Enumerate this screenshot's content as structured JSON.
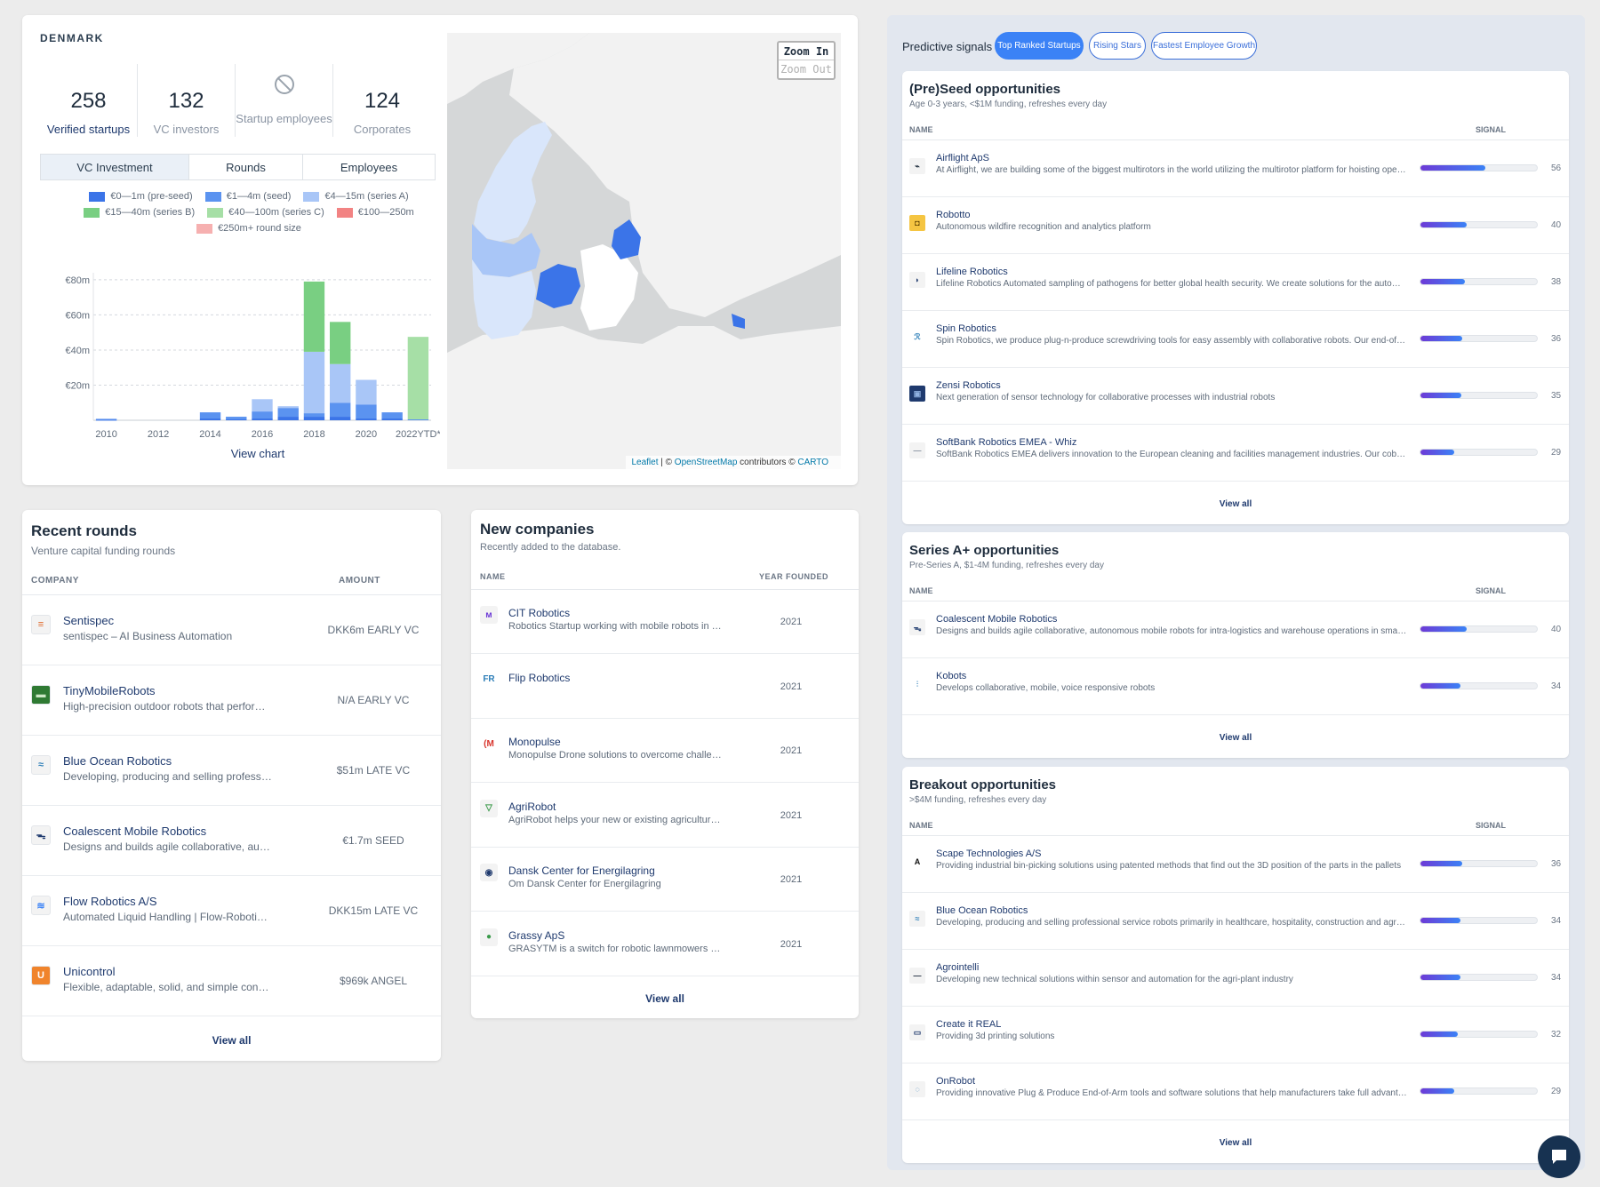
{
  "overview": {
    "country": "DENMARK",
    "stats": [
      {
        "value": "258",
        "label": "Verified startups"
      },
      {
        "value": "132",
        "label": "VC investors"
      },
      {
        "value": "",
        "label": "Startup employees"
      },
      {
        "value": "124",
        "label": "Corporates"
      }
    ],
    "tabs": [
      "VC Investment",
      "Rounds",
      "Employees"
    ],
    "legend": [
      {
        "label": "€0—1m (pre-seed)",
        "color": "#3b74e8"
      },
      {
        "label": "€1—4m (seed)",
        "color": "#5b93f0"
      },
      {
        "label": "€4—15m (series A)",
        "color": "#a9c6f7"
      },
      {
        "label": "€15—40m (series B)",
        "color": "#79cf82"
      },
      {
        "label": "€40—100m (series C)",
        "color": "#a6dfa6"
      },
      {
        "label": "€100—250m",
        "color": "#f28383"
      },
      {
        "label": "€250m+ round size",
        "color": "#f6b0b0"
      }
    ],
    "view_chart": "View chart"
  },
  "chart_data": {
    "type": "bar",
    "categories": [
      "2010",
      "2011",
      "2012",
      "2013",
      "2014",
      "2015",
      "2016",
      "2017",
      "2018",
      "2019",
      "2020",
      "2021",
      "2022YTD*"
    ],
    "tick_labels": [
      "2010",
      "2012",
      "2014",
      "2016",
      "2018",
      "2020",
      "2022YTD*"
    ],
    "yticks": [
      "€20m",
      "€40m",
      "€60m",
      "€80m"
    ],
    "ylim": [
      0,
      84
    ],
    "stacked": true,
    "series": [
      {
        "name": "€0—1m (pre-seed)",
        "color": "#3b74e8",
        "values": [
          0.3,
          0,
          0,
          0,
          1,
          0.5,
          1,
          2,
          2,
          2,
          1,
          1,
          0
        ]
      },
      {
        "name": "€1—4m (seed)",
        "color": "#5b93f0",
        "values": [
          0.5,
          0,
          0,
          0,
          3.5,
          1.5,
          4,
          5,
          2,
          8,
          8,
          3.5,
          0.5
        ]
      },
      {
        "name": "€4—15m (series A)",
        "color": "#a9c6f7",
        "values": [
          0,
          0,
          0,
          0,
          0,
          0,
          7,
          1,
          35,
          22,
          14,
          0,
          0
        ]
      },
      {
        "name": "€15—40m (series B)",
        "color": "#79cf82",
        "values": [
          0,
          0,
          0,
          0,
          0,
          0,
          0,
          0,
          40,
          24,
          0,
          0,
          0
        ]
      },
      {
        "name": "€40—100m (series C)",
        "color": "#a6dfa6",
        "values": [
          0,
          0,
          0,
          0,
          0,
          0,
          0,
          0,
          0,
          0,
          0,
          0,
          47
        ]
      }
    ]
  },
  "map": {
    "zoom_in": "Zoom In",
    "zoom_out": "Zoom Out",
    "attribution_leaflet": "Leaflet",
    "attribution_sep": " | © ",
    "attribution_osm": "OpenStreetMap",
    "attribution_mid": " contributors © ",
    "attribution_carto": "CARTO"
  },
  "recent_rounds": {
    "title": "Recent rounds",
    "subtitle": "Venture capital funding rounds",
    "col_company": "COMPANY",
    "col_amount": "AMOUNT",
    "rows": [
      {
        "name": "Sentispec",
        "desc": "sentispec – AI Business Automation",
        "amount": "DKK6m EARLY VC",
        "logo_color": "#f3f3f3",
        "logo_text": "≡",
        "logo_fg": "#e06a2c"
      },
      {
        "name": "TinyMobileRobots",
        "desc": "High-precision outdoor robots that perform line marking and layout",
        "amount": "N/A EARLY VC",
        "logo_color": "#2f7a33",
        "logo_text": "▬",
        "logo_fg": "#cde8c6"
      },
      {
        "name": "Blue Ocean Robotics",
        "desc": "Developing, producing and selling professional service robots",
        "amount": "$51m LATE VC",
        "logo_color": "#f3f3f3",
        "logo_text": "≈",
        "logo_fg": "#2e7fb8"
      },
      {
        "name": "Coalescent Mobile Robotics",
        "desc": "Designs and builds agile collaborative, autonomous mobile robots",
        "amount": "€1.7m SEED",
        "logo_color": "#f3f3f3",
        "logo_text": "ᯓ",
        "logo_fg": "#1f3a6e"
      },
      {
        "name": "Flow Robotics A/S",
        "desc": "Automated Liquid Handling | Flow-Robotics flowbot ONE",
        "amount": "DKK15m LATE VC",
        "logo_color": "#f3f3f3",
        "logo_text": "≋",
        "logo_fg": "#3b82f6"
      },
      {
        "name": "Unicontrol",
        "desc": "Flexible, adaptable, solid, and simple construction technology",
        "amount": "$969k ANGEL",
        "logo_color": "#f0842c",
        "logo_text": "U",
        "logo_fg": "#ffffff"
      }
    ],
    "view_all": "View all"
  },
  "new_companies": {
    "title": "New companies",
    "subtitle": "Recently added to the database.",
    "col_name": "NAME",
    "col_year": "YEAR FOUNDED",
    "rows": [
      {
        "name": "CIT Robotics",
        "desc": "Robotics Startup working with mobile robots in logistics",
        "year": "2021",
        "logo_color": "#f3f3f3",
        "logo_text": "ᴍ",
        "logo_fg": "#6d3ad6"
      },
      {
        "name": "Flip Robotics",
        "desc": "",
        "year": "2021",
        "logo_color": "#ffffff",
        "logo_text": "FR",
        "logo_fg": "#2e7fb8"
      },
      {
        "name": "Monopulse",
        "desc": "Monopulse Drone solutions to overcome challenges",
        "year": "2021",
        "logo_color": "#ffffff",
        "logo_text": "(M",
        "logo_fg": "#d8342c"
      },
      {
        "name": "AgriRobot",
        "desc": "AgriRobot helps your new or existing agriculture business",
        "year": "2021",
        "logo_color": "#f3f3f3",
        "logo_text": "▽",
        "logo_fg": "#3a9a4a"
      },
      {
        "name": "Dansk Center for Energilagring",
        "desc": "Om Dansk Center for Energilagring",
        "year": "2021",
        "logo_color": "#f3f3f3",
        "logo_text": "◉",
        "logo_fg": "#1f3a6e"
      },
      {
        "name": "Grassy ApS",
        "desc": "GRASYTM is a switch for robotic lawnmowers and more",
        "year": "2021",
        "logo_color": "#f3f3f3",
        "logo_text": "●",
        "logo_fg": "#3a9a4a"
      }
    ],
    "view_all": "View all"
  },
  "predictive": {
    "label": "Predictive signals",
    "pills": [
      "Top Ranked Startups",
      "Rising Stars",
      "Fastest Employee Growth"
    ],
    "col_name": "NAME",
    "col_signal": "SIGNAL",
    "sections": [
      {
        "title": "(Pre)Seed opportunities",
        "subtitle": "Age 0-3 years, <$1M funding, refreshes every day",
        "view_all": "View all",
        "rows": [
          {
            "name": "Airflight ApS",
            "desc": "At Airflight, we are building some of the biggest multirotors in the world utilizing the multirotor platform for hoisting operations",
            "signal": 56,
            "logo_color": "#f3f3f3",
            "logo_text": "⌁",
            "logo_fg": "#1f2d3d"
          },
          {
            "name": "Robotto",
            "desc": "Autonomous wildfire recognition and analytics platform",
            "signal": 40,
            "logo_color": "#f5c542",
            "logo_text": "◘",
            "logo_fg": "#5a3e00"
          },
          {
            "name": "Lifeline Robotics",
            "desc": "Lifeline Robotics Automated sampling of pathogens for better global health security. We create solutions for the automation of testing",
            "signal": 38,
            "logo_color": "#f3f3f3",
            "logo_text": "◗",
            "logo_fg": "#1f3a6e"
          },
          {
            "name": "Spin Robotics",
            "desc": "Spin Robotics, we produce plug-n-produce screwdriving tools for easy assembly with collaborative robots. Our end-of-arm tools are",
            "signal": 36,
            "logo_color": "#ffffff",
            "logo_text": "ℛ",
            "logo_fg": "#2e7fb8"
          },
          {
            "name": "Zensi Robotics",
            "desc": "Next generation of sensor technology for collaborative processes with industrial robots",
            "signal": 35,
            "logo_color": "#1f3a6e",
            "logo_text": "▣",
            "logo_fg": "#8fb0e0"
          },
          {
            "name": "SoftBank Robotics EMEA - Whiz",
            "desc": "SoftBank Robotics EMEA delivers innovation to the European cleaning and facilities management industries. Our cobotic solutions",
            "signal": 29,
            "logo_color": "#f3f3f3",
            "logo_text": "—",
            "logo_fg": "#8a94a3"
          }
        ]
      },
      {
        "title": "Series A+ opportunities",
        "subtitle": "Pre-Series A, $1-4M funding, refreshes every day",
        "view_all": "View all",
        "rows": [
          {
            "name": "Coalescent Mobile Robotics",
            "desc": "Designs and builds agile collaborative, autonomous mobile robots for intra-logistics and warehouse operations in small and medium",
            "signal": 40,
            "logo_color": "#f3f3f3",
            "logo_text": "ᯓ",
            "logo_fg": "#1f3a6e"
          },
          {
            "name": "Kobots",
            "desc": "Develops collaborative, mobile, voice responsive robots",
            "signal": 34,
            "logo_color": "#ffffff",
            "logo_text": "⫶",
            "logo_fg": "#2e7fb8"
          }
        ]
      },
      {
        "title": "Breakout opportunities",
        "subtitle": ">$4M funding, refreshes every day",
        "view_all": "View all",
        "rows": [
          {
            "name": "Scape Technologies A/S",
            "desc": "Providing industrial bin-picking solutions using patented methods that find out the 3D position of the parts in the pallets",
            "signal": 36,
            "logo_color": "#ffffff",
            "logo_text": "A",
            "logo_fg": "#111111"
          },
          {
            "name": "Blue Ocean Robotics",
            "desc": "Developing, producing and selling professional service robots primarily in healthcare, hospitality, construction and agriculture",
            "signal": 34,
            "logo_color": "#f3f3f3",
            "logo_text": "≈",
            "logo_fg": "#2e7fb8"
          },
          {
            "name": "Agrointelli",
            "desc": "Developing new technical solutions within sensor and automation for the agri-plant industry",
            "signal": 34,
            "logo_color": "#f3f3f3",
            "logo_text": "—",
            "logo_fg": "#1f2d3d"
          },
          {
            "name": "Create it REAL",
            "desc": "Providing 3d printing solutions",
            "signal": 32,
            "logo_color": "#f3f3f3",
            "logo_text": "▭",
            "logo_fg": "#1f3a6e"
          },
          {
            "name": "OnRobot",
            "desc": "Providing innovative Plug & Produce End-of-Arm tools and software solutions that help manufacturers take full advantage of automation",
            "signal": 29,
            "logo_color": "#f3f3f3",
            "logo_text": "◌",
            "logo_fg": "#2e7fb8"
          }
        ]
      }
    ]
  }
}
